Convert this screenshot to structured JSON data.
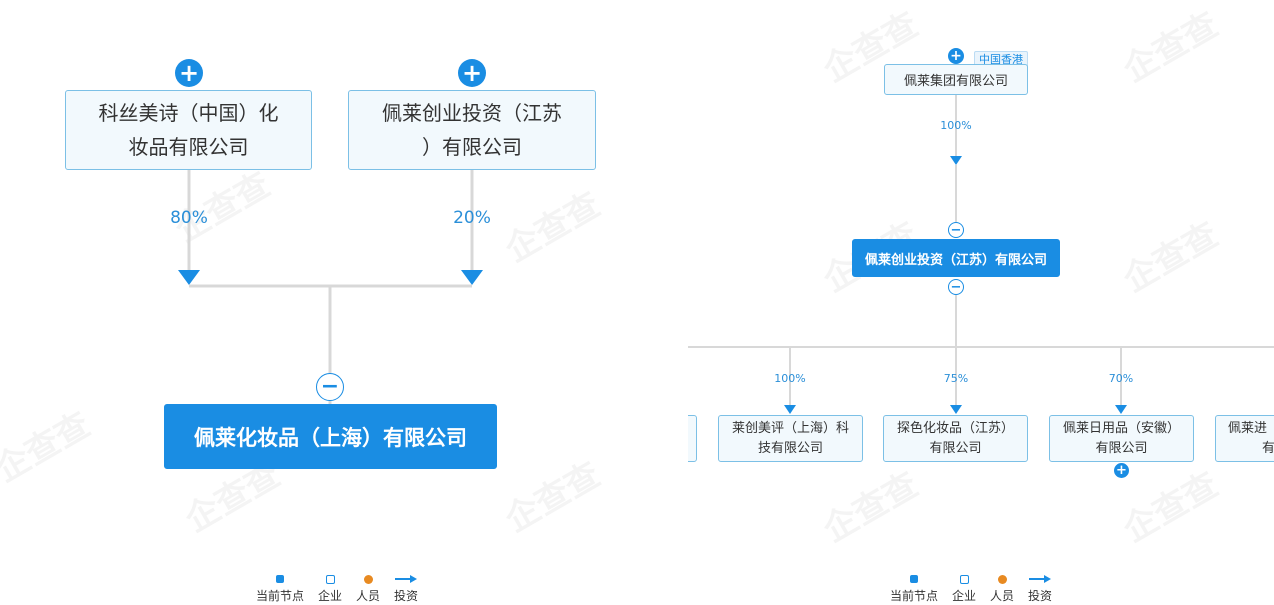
{
  "left_diagram": {
    "shareholders": [
      {
        "name": "科丝美诗（中国）化妆品有限公司",
        "line1": "科丝美诗（中国）化",
        "line2": "妆品有限公司",
        "percent": "80%"
      },
      {
        "name": "佩莱创业投资（江苏）有限公司",
        "line1": "佩莱创业投资（江苏",
        "line2": "）有限公司",
        "percent": "20%"
      }
    ],
    "current_node": "佩莱化妆品（上海）有限公司"
  },
  "right_diagram": {
    "parent": {
      "name": "佩莱集团有限公司",
      "tag": "中国香港",
      "percent": "100%"
    },
    "current_node": "佩莱创业投资（江苏）有限公司",
    "subsidiaries": [
      {
        "line1": "",
        "line2": "",
        "percent": ""
      },
      {
        "line1": "莱创美评（上海）科",
        "line2": "技有限公司",
        "percent": "100%"
      },
      {
        "line1": "探色化妆品（江苏）",
        "line2": "有限公司",
        "percent": "75%"
      },
      {
        "line1": "佩莱日用品（安徽）",
        "line2": "有限公司",
        "percent": "70%"
      },
      {
        "line1": "佩莱进",
        "line2": "有",
        "percent": ""
      }
    ]
  },
  "legend": {
    "current": "当前节点",
    "company": "企业",
    "person": "人员",
    "investment": "投资"
  },
  "controls": {
    "expand": "+",
    "collapse": "−"
  },
  "watermark": "企查查",
  "colors": {
    "primary": "#1a8de3",
    "border": "#7cc0e6",
    "line": "#d8d8d8",
    "person": "#e88a21"
  }
}
